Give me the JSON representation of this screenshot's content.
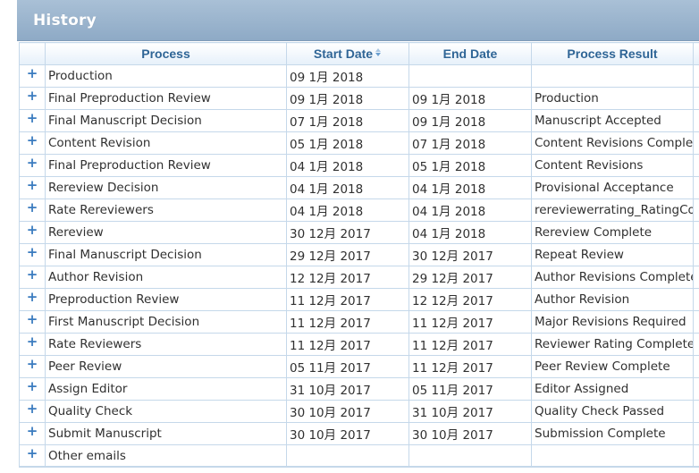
{
  "panel": {
    "title": "History"
  },
  "columns": {
    "process": "Process",
    "start_date": "Start Date",
    "end_date": "End Date",
    "process_result": "Process Result"
  },
  "expand_glyph": "+",
  "rows": [
    {
      "process": "Production",
      "start": "09 1月 2018",
      "end": "",
      "result": ""
    },
    {
      "process": "Final Preproduction Review",
      "start": "09 1月 2018",
      "end": "09 1月 2018",
      "result": "Production"
    },
    {
      "process": "Final Manuscript Decision",
      "start": "07 1月 2018",
      "end": "09 1月 2018",
      "result": "Manuscript Accepted"
    },
    {
      "process": "Content Revision",
      "start": "05 1月 2018",
      "end": "07 1月 2018",
      "result": "Content Revisions Complete"
    },
    {
      "process": "Final Preproduction Review",
      "start": "04 1月 2018",
      "end": "05 1月 2018",
      "result": "Content Revisions"
    },
    {
      "process": "Rereview Decision",
      "start": "04 1月 2018",
      "end": "04 1月 2018",
      "result": "Provisional Acceptance"
    },
    {
      "process": "Rate Rereviewers",
      "start": "04 1月 2018",
      "end": "04 1月 2018",
      "result": "rereviewerrating_RatingComp"
    },
    {
      "process": "Rereview",
      "start": "30 12月 2017",
      "end": "04 1月 2018",
      "result": "Rereview Complete"
    },
    {
      "process": "Final Manuscript Decision",
      "start": "29 12月 2017",
      "end": "30 12月 2017",
      "result": "Repeat Review"
    },
    {
      "process": "Author Revision",
      "start": "12 12月 2017",
      "end": "29 12月 2017",
      "result": "Author Revisions Complete"
    },
    {
      "process": "Preproduction Review",
      "start": "11 12月 2017",
      "end": "12 12月 2017",
      "result": "Author Revision"
    },
    {
      "process": "First Manuscript Decision",
      "start": "11 12月 2017",
      "end": "11 12月 2017",
      "result": "Major Revisions Required"
    },
    {
      "process": "Rate Reviewers",
      "start": "11 12月 2017",
      "end": "11 12月 2017",
      "result": "Reviewer Rating Completed"
    },
    {
      "process": "Peer Review",
      "start": "05 11月 2017",
      "end": "11 12月 2017",
      "result": "Peer Review Complete"
    },
    {
      "process": "Assign Editor",
      "start": "31 10月 2017",
      "end": "05 11月 2017",
      "result": "Editor Assigned"
    },
    {
      "process": "Quality Check",
      "start": "30 10月 2017",
      "end": "31 10月 2017",
      "result": "Quality Check Passed"
    },
    {
      "process": "Submit Manuscript",
      "start": "30 10月 2017",
      "end": "30 10月 2017",
      "result": "Submission Complete"
    },
    {
      "process": "Other emails",
      "start": "",
      "end": "",
      "result": ""
    }
  ]
}
